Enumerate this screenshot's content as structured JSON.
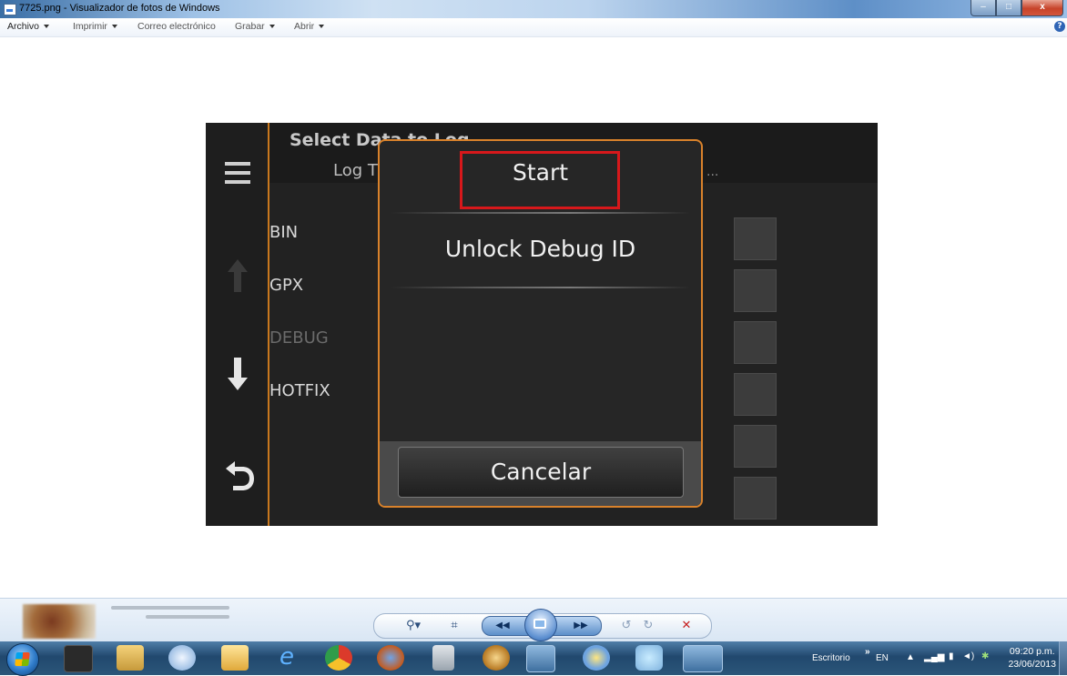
{
  "window": {
    "title": "7725.png - Visualizador de fotos de Windows",
    "buttons": {
      "minimize": "–",
      "maximize": "□",
      "close": "x"
    }
  },
  "menu": {
    "items": [
      "Archivo",
      "Imprimir",
      "Correo electrónico",
      "Grabar",
      "Abrir"
    ],
    "help": "?"
  },
  "device": {
    "title": "Select Data to Log",
    "subtitle": "Log T",
    "ellipsis": "...",
    "options": [
      "BIN",
      "GPX",
      "DEBUG",
      "HOTFIX"
    ],
    "dimmed_option": "DEBUG"
  },
  "dialog": {
    "items": [
      "Start",
      "Unlock Debug ID"
    ],
    "cancel_label": "Cancelar",
    "highlighted_item": "Start",
    "border_color": "#d9822b"
  },
  "viewer_controls": {
    "zoom": "⚲▾",
    "fit": "⌗",
    "prev": "◀◀",
    "next": "▶▶",
    "rotate_ccw": "↺",
    "rotate_cw": "↻",
    "delete": "✕"
  },
  "taskbar": {
    "desktop_label": "Escritorio",
    "chevron": "»",
    "lang": "EN",
    "time": "09:20 p.m.",
    "date": "23/06/2013"
  }
}
